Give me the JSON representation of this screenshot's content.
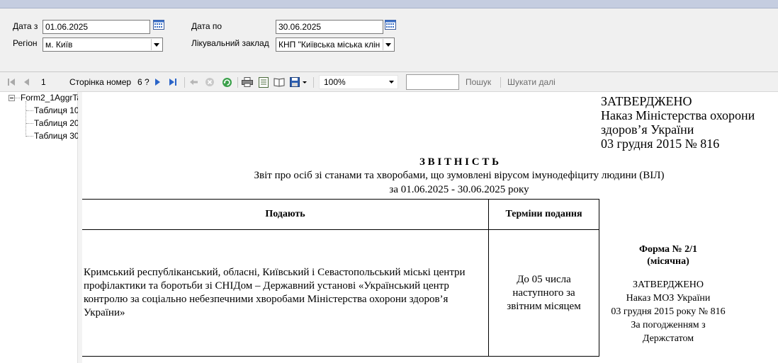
{
  "filters": {
    "date_from_label": "Дата з",
    "date_from_value": "01.06.2025",
    "date_to_label": "Дата по",
    "date_to_value": "30.06.2025",
    "region_label": "Регіон",
    "region_value": "м. Київ",
    "facility_label": "Лікувальний заклад",
    "facility_value": "КНП \"Київська міська клін"
  },
  "toolbar": {
    "page_value": "1",
    "page_number_label": "Сторінка номер",
    "page_total": "6 ?",
    "zoom_value": "100%",
    "search_label": "Пошук",
    "find_next_label": "Шукати далі",
    "search_placeholder": ""
  },
  "tree": {
    "root": "Form2_1AggrTa",
    "items": [
      "Таблиця 10",
      "Таблиця 20",
      "Таблиця 30"
    ]
  },
  "report": {
    "approved": [
      "ЗАТВЕРДЖЕНО",
      "Наказ Міністерства охорони",
      "здоров’я України",
      "03 грудня 2015 № 816"
    ],
    "heading": "З В І Т Н І С Т Ь",
    "subtitle": "Звіт про осіб зі станами та хворобами, що зумовлені вірусом імунодефіциту людини (ВІЛ)",
    "period": "за 01.06.2025 -  30.06.2025 року",
    "table": {
      "col1_header": "Подають",
      "col2_header": "Терміни подання",
      "col1_text": "Кримський республіканський, обласні, Київський і Севастопольський міські центри профілактики та боротьби зі СНІДом – Державний установі «Український центр контролю за соціально небезпечними хворобами Міністерства охорони здоров’я України»",
      "col2_text": "До 05 числа наступного за звітним місяцем"
    },
    "form_no": "Форма № 2/1",
    "form_period": "(місячна)",
    "form_approved": "ЗАТВЕРДЖЕНО",
    "form_order": "Наказ МОЗ України",
    "form_date": "03 грудня 2015 року № 816",
    "form_agreed": "За погодженням з",
    "form_agency": "Держстатом"
  }
}
